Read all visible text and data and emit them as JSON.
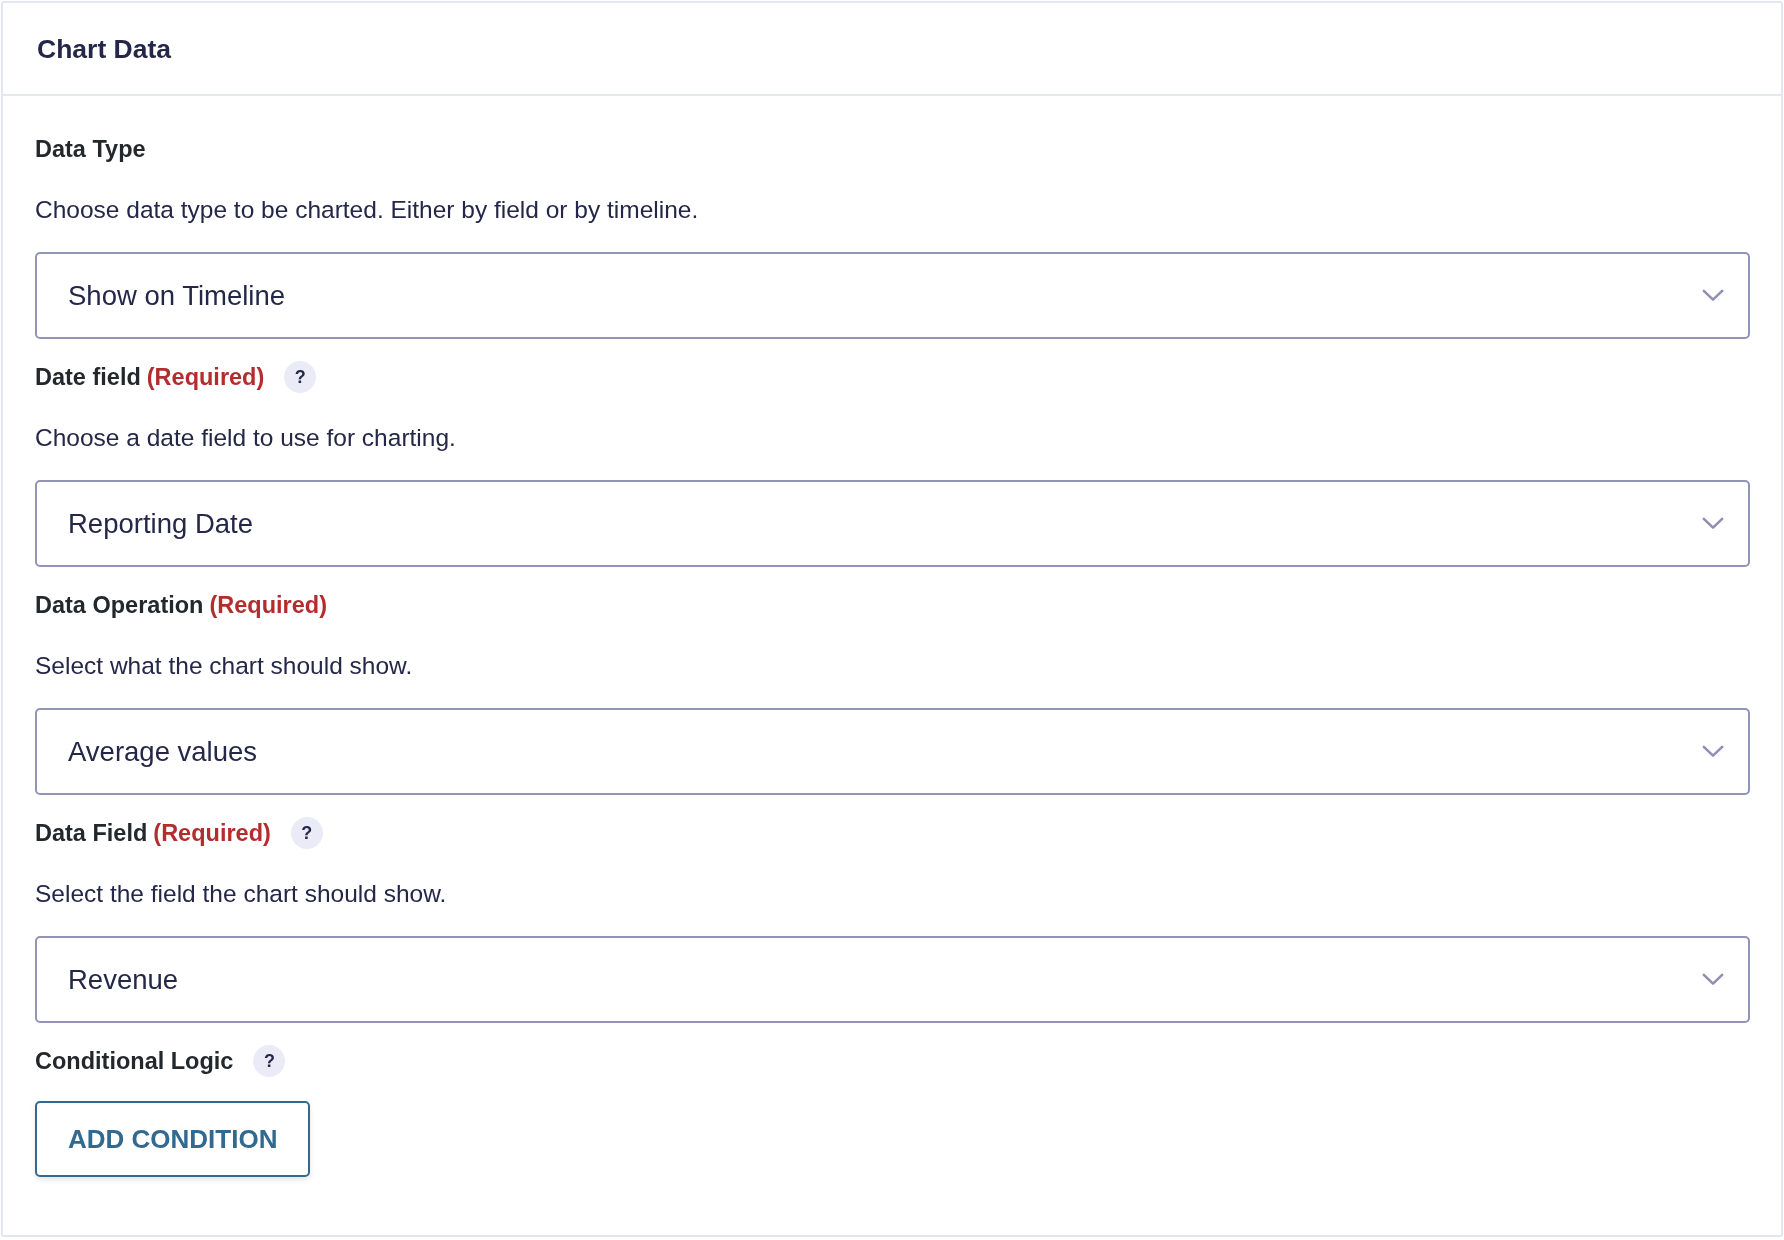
{
  "panel": {
    "title": "Chart Data"
  },
  "fields": [
    {
      "kind": "select",
      "label": "Data Type",
      "description": "Choose data type to be charted. Either by field or by timeline.",
      "value": "Show on Timeline"
    },
    {
      "kind": "select",
      "label": "Date field",
      "required": "(Required)",
      "help": "?",
      "description": "Choose a date field to use for charting.",
      "value": "Reporting Date"
    },
    {
      "kind": "select",
      "label": "Data Operation",
      "required": "(Required)",
      "description": "Select what the chart should show.",
      "value": "Average values"
    },
    {
      "kind": "select",
      "label": "Data Field",
      "required": "(Required)",
      "help": "?",
      "description": "Select the field the chart should show.",
      "value": "Revenue"
    },
    {
      "kind": "button",
      "label": "Conditional Logic",
      "help": "?",
      "button": "ADD CONDITION"
    }
  ]
}
